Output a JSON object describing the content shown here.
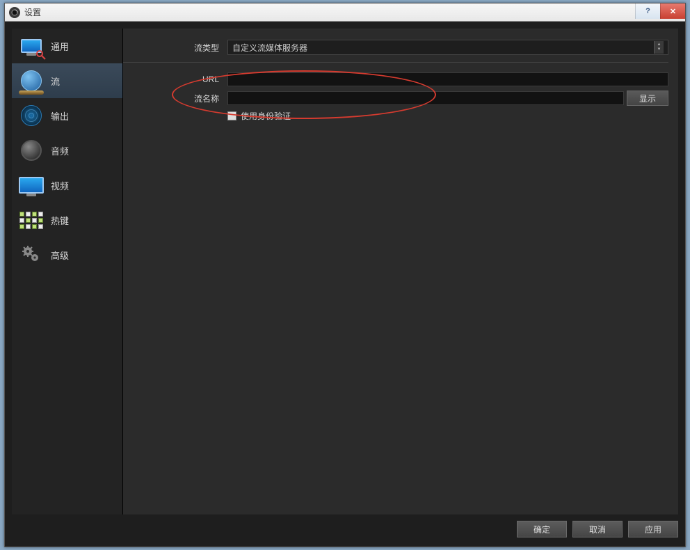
{
  "window": {
    "title": "设置"
  },
  "sidebar": {
    "items": [
      {
        "label": "通用"
      },
      {
        "label": "流"
      },
      {
        "label": "输出"
      },
      {
        "label": "音频"
      },
      {
        "label": "视频"
      },
      {
        "label": "热键"
      },
      {
        "label": "高级"
      }
    ]
  },
  "form": {
    "stream_type_label": "流类型",
    "stream_type_value": "自定义流媒体服务器",
    "url_label": "URL",
    "url_value": "",
    "stream_key_label": "流名称",
    "stream_key_value": "",
    "show_button": "显示",
    "use_auth_label": "使用身份验证"
  },
  "buttons": {
    "ok": "确定",
    "cancel": "取消",
    "apply": "应用"
  }
}
